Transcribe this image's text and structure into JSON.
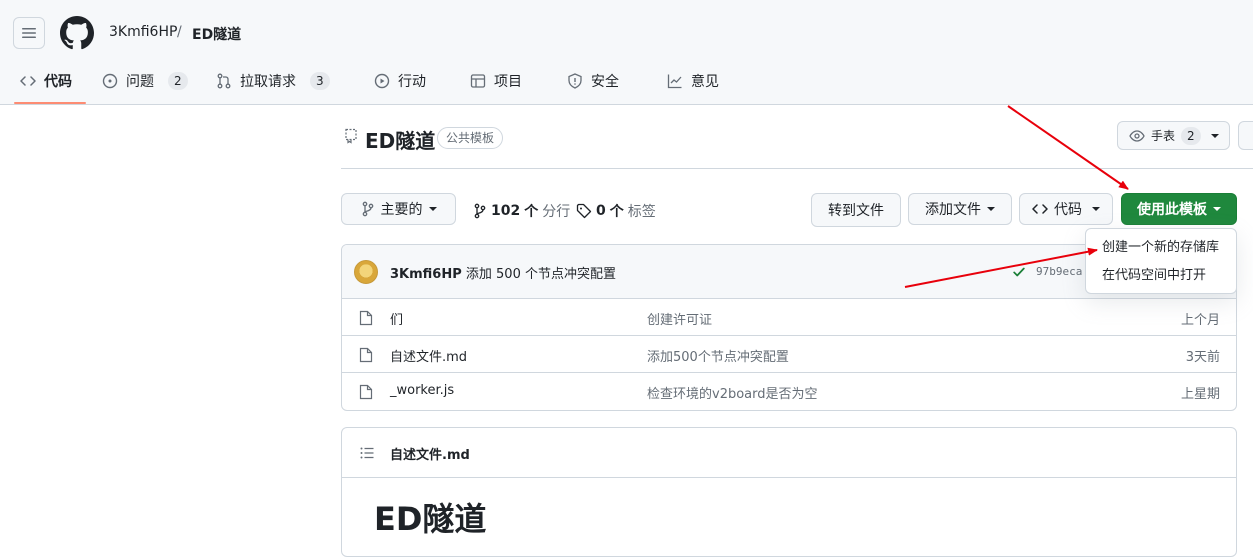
{
  "breadcrumb": {
    "owner": "3Kmfi6HP",
    "separator": "/",
    "repo": "ED隧道"
  },
  "tabs": [
    {
      "label": "代码",
      "icon": "code-icon",
      "count": null
    },
    {
      "label": "问题",
      "icon": "issue-icon",
      "count": "2"
    },
    {
      "label": "拉取请求",
      "icon": "pull-request-icon",
      "count": "3"
    },
    {
      "label": "行动",
      "icon": "play-icon",
      "count": null
    },
    {
      "label": "项目",
      "icon": "table-icon",
      "count": null
    },
    {
      "label": "安全",
      "icon": "shield-icon",
      "count": null
    },
    {
      "label": "意见",
      "icon": "graph-icon",
      "count": null
    }
  ],
  "repo": {
    "title": "ED隧道",
    "visibility": "公共模板"
  },
  "watch": {
    "label": "手表",
    "count": "2"
  },
  "branch": {
    "label": "主要的",
    "branches_count": "102",
    "branches_word": "个",
    "branches_label": "分行",
    "tags_count": "0",
    "tags_word": "个",
    "tags_label": "标签"
  },
  "actions": {
    "goto_file": "转到文件",
    "add_file": "添加文件",
    "code": "代码",
    "use_template": "使用此模板"
  },
  "dropdown": {
    "items": [
      "创建一个新的存储库",
      "在代码空间中打开"
    ]
  },
  "commit": {
    "author": "3Kmfi6HP",
    "message": "添加 500 个节点冲突配置",
    "sha": "97b9eca"
  },
  "files": [
    {
      "name": "们",
      "message": "创建许可证",
      "date": "上个月"
    },
    {
      "name": "自述文件.md",
      "message": "添加500个节点冲突配置",
      "date": "3天前"
    },
    {
      "name": "_worker.js",
      "message": "检查环境的v2board是否为空",
      "date": "上星期"
    }
  ],
  "readme": {
    "filename": "自述文件.md",
    "heading": "ED隧道"
  },
  "colors": {
    "accent_green": "#1f883d",
    "annotation_red": "#e8000b",
    "tab_underline": "#fd8c73"
  }
}
